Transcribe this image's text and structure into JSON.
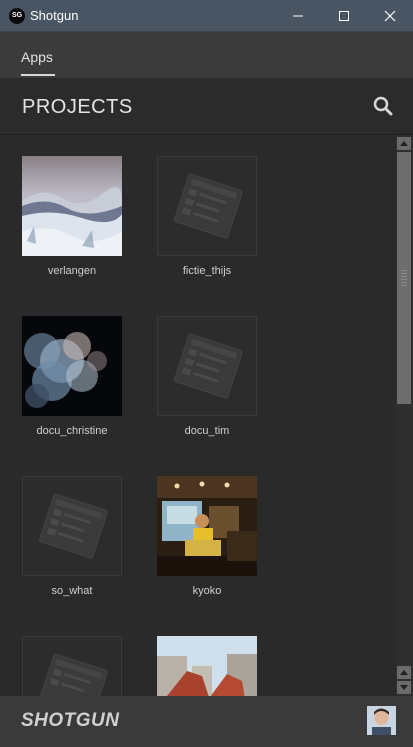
{
  "window": {
    "title": "Shotgun",
    "logo_text": "SG"
  },
  "tabs": [
    {
      "label": "Apps",
      "active": true
    }
  ],
  "header": {
    "title": "PROJECTS"
  },
  "projects": [
    {
      "name": "verlangen",
      "has_thumbnail": true
    },
    {
      "name": "fictie_thijs",
      "has_thumbnail": false
    },
    {
      "name": "docu_christine",
      "has_thumbnail": true
    },
    {
      "name": "docu_tim",
      "has_thumbnail": false
    },
    {
      "name": "so_what",
      "has_thumbnail": false
    },
    {
      "name": "kyoko",
      "has_thumbnail": true
    },
    {
      "name": "",
      "has_thumbnail": false
    },
    {
      "name": "",
      "has_thumbnail": true
    }
  ],
  "footer": {
    "brand": "SHOTGUN"
  },
  "colors": {
    "titlebar": "#4a5563",
    "background": "#2b2b2b",
    "tabbar": "#3b3b3b",
    "footer": "#3a3a3a"
  }
}
